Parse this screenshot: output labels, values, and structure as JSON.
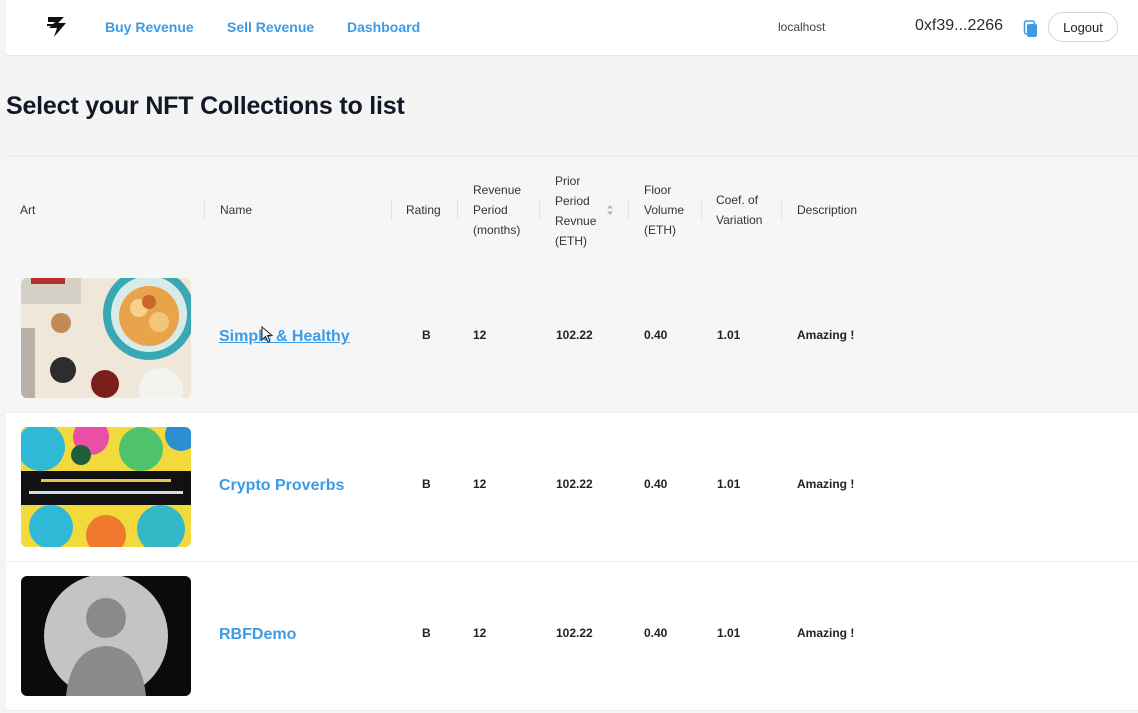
{
  "nav": {
    "buy_revenue": "Buy Revenue",
    "sell_revenue": "Sell Revenue",
    "dashboard": "Dashboard",
    "host": "localhost",
    "wallet_address": "0xf39...2266",
    "logout": "Logout",
    "accent_color": "#3b9be6"
  },
  "page": {
    "title": "Select your NFT Collections to list"
  },
  "table": {
    "headers": {
      "art": "Art",
      "name": "Name",
      "rating": "Rating",
      "revenue_period": [
        "Revenue",
        "Period",
        "(months)"
      ],
      "prior_period": [
        "Prior",
        "Period",
        "Revnue",
        "(ETH)"
      ],
      "floor_volume": [
        "Floor",
        "Volume",
        "(ETH)"
      ],
      "coef_variation": [
        "Coef. of",
        "Variation"
      ],
      "description": "Description"
    },
    "rows": [
      {
        "name": "Simple & Healthy",
        "art": "food-photo",
        "rating": "B",
        "revenue_period": "12",
        "prior_period": "102.22",
        "floor_volume": "0.40",
        "coef_variation": "1.01",
        "description": "Amazing !"
      },
      {
        "name": "Crypto Proverbs",
        "art": "colorful-proverb-art",
        "rating": "B",
        "revenue_period": "12",
        "prior_period": "102.22",
        "floor_volume": "0.40",
        "coef_variation": "1.01",
        "description": "Amazing !"
      },
      {
        "name": "RBFDemo",
        "art": "default-avatar-silhouette",
        "rating": "B",
        "revenue_period": "12",
        "prior_period": "102.22",
        "floor_volume": "0.40",
        "coef_variation": "1.01",
        "description": "Amazing !"
      }
    ]
  },
  "icons": {
    "logo": "brand-logo-icon",
    "copy": "copy-icon",
    "sort": "sort-icon",
    "cursor": "mouse-pointer-icon"
  }
}
